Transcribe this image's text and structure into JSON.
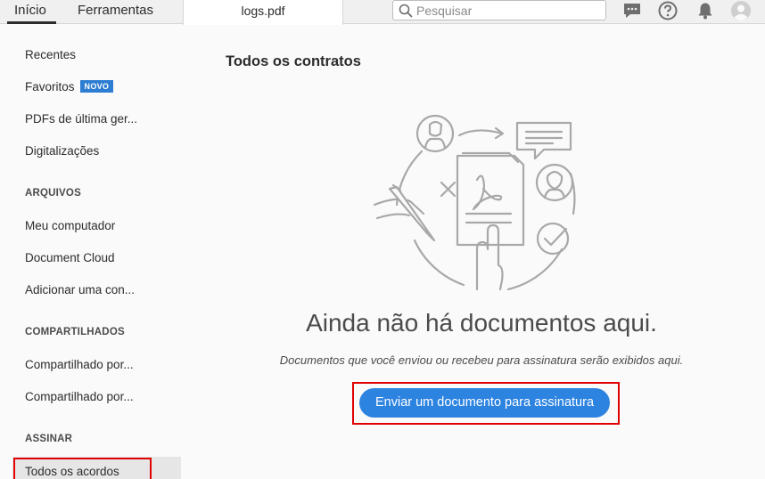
{
  "topbar": {
    "tabs": [
      {
        "label": "Início",
        "active": true
      },
      {
        "label": "Ferramentas",
        "active": false
      }
    ],
    "document_tab": "logs.pdf",
    "search": {
      "placeholder": "Pesquisar",
      "value": ""
    },
    "icons": [
      "chat-icon",
      "help-icon",
      "bell-icon",
      "user-avatar-icon"
    ]
  },
  "sidebar": {
    "recent": [
      {
        "label": "Recentes"
      },
      {
        "label": "Favoritos",
        "badge": "NOVO"
      },
      {
        "label": "PDFs de última ger..."
      },
      {
        "label": "Digitalizações"
      }
    ],
    "files": {
      "heading": "ARQUIVOS",
      "items": [
        "Meu computador",
        "Document Cloud",
        "Adicionar uma con..."
      ]
    },
    "shared": {
      "heading": "COMPARTILHADOS",
      "items": [
        "Compartilhado por...",
        "Compartilhado por..."
      ]
    },
    "sign": {
      "heading": "ASSINAR",
      "items": [
        "Todos os acordos"
      ],
      "selected": "Todos os acordos"
    }
  },
  "main": {
    "title": "Todos os contratos",
    "empty_title": "Ainda não há documentos aqui.",
    "empty_description": "Documentos que você enviou ou recebeu para assinatura serão exibidos aqui.",
    "button_label": "Enviar um documento para assinatura"
  },
  "colors": {
    "accent": "#2d83e0",
    "badge": "#2d7dd2",
    "highlight": "#e00000"
  }
}
